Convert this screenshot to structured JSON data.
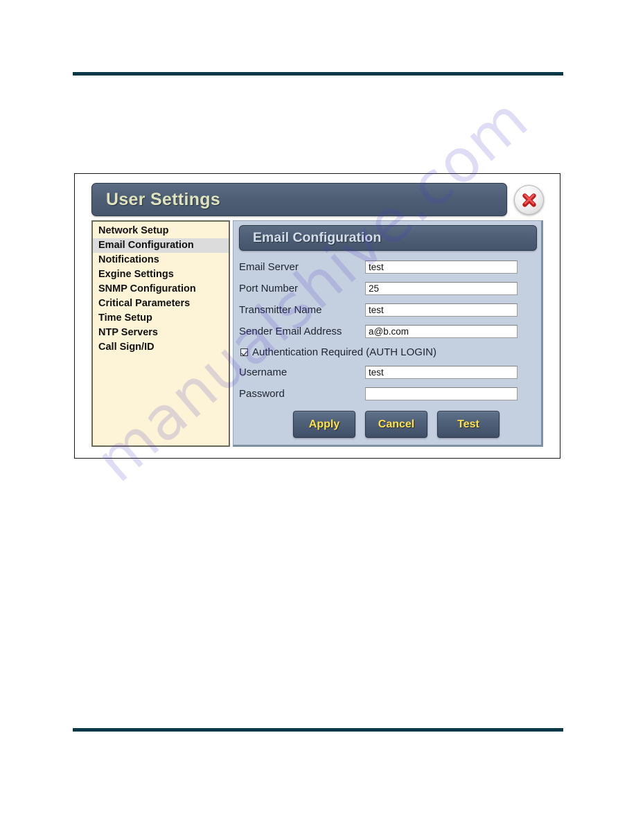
{
  "dialog": {
    "title": "User Settings",
    "close_icon": "close-icon"
  },
  "sidebar": {
    "items": [
      {
        "label": "Network Setup",
        "selected": false
      },
      {
        "label": "Email Configuration",
        "selected": true
      },
      {
        "label": "Notifications",
        "selected": false
      },
      {
        "label": "Exgine Settings",
        "selected": false
      },
      {
        "label": "SNMP Configuration",
        "selected": false
      },
      {
        "label": "Critical Parameters",
        "selected": false
      },
      {
        "label": "Time Setup",
        "selected": false
      },
      {
        "label": "NTP Servers",
        "selected": false
      },
      {
        "label": "Call Sign/ID",
        "selected": false
      }
    ]
  },
  "content": {
    "header": "Email Configuration",
    "fields": [
      {
        "label": "Email Server",
        "value": "test",
        "name": "email-server"
      },
      {
        "label": "Port Number",
        "value": "25",
        "name": "port-number"
      },
      {
        "label": "Transmitter Name",
        "value": "test",
        "name": "transmitter-name"
      },
      {
        "label": "Sender Email Address",
        "value": "a@b.com",
        "name": "sender-email-address"
      }
    ],
    "auth_checkbox": {
      "label": "Authentication Required (AUTH LOGIN)",
      "checked": true
    },
    "credentials": [
      {
        "label": "Username",
        "value": "test",
        "name": "username"
      },
      {
        "label": "Password",
        "value": "",
        "name": "password"
      }
    ],
    "buttons": [
      {
        "label": "Apply",
        "name": "apply-button"
      },
      {
        "label": "Cancel",
        "name": "cancel-button"
      },
      {
        "label": "Test",
        "name": "test-button"
      }
    ]
  },
  "page": {
    "watermark": "manualshive.com"
  },
  "colors": {
    "rule": "#083747",
    "title_bar": "#4e5f76",
    "title_text": "#dfe3bd",
    "sidebar_bg": "#fdf3d6",
    "sidebar_selected": "#dcdcdc",
    "content_bg": "#c4cfe0",
    "button_text": "#ffe14d",
    "close_x": "#d42b2b",
    "watermark": "#4a3cc8"
  }
}
